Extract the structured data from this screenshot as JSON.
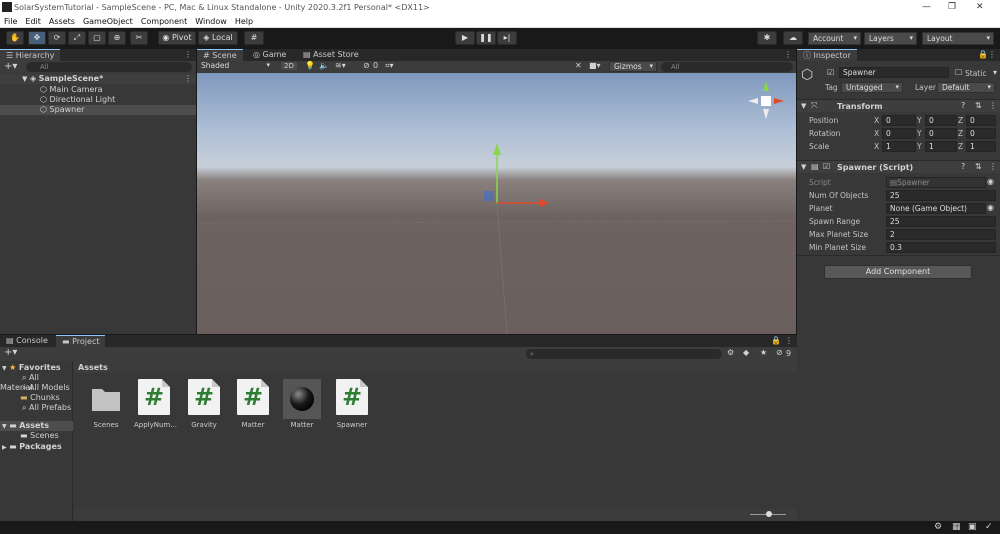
{
  "window": {
    "title": "SolarSystemTutorial - SampleScene - PC, Mac & Linux Standalone - Unity 2020.3.2f1 Personal* <DX11>",
    "minimize": "—",
    "maximize": "❐",
    "close": "✕"
  },
  "menu": [
    "File",
    "Edit",
    "Assets",
    "GameObject",
    "Component",
    "Window",
    "Help"
  ],
  "toolbar": {
    "pivot": "Pivot",
    "local": "Local",
    "account": "Account",
    "layers": "Layers",
    "layout": "Layout"
  },
  "hierarchy": {
    "tab": "Hierarchy",
    "search_placeholder": "All",
    "scene": "SampleScene*",
    "items": [
      "Main Camera",
      "Directional Light",
      "Spawner"
    ]
  },
  "scene_view": {
    "tabs": [
      "Scene",
      "Game",
      "Asset Store"
    ],
    "shading": "Shaded",
    "mode": "2D",
    "hidden_count": "0",
    "gizmos": "Gizmos",
    "search_placeholder": "All"
  },
  "inspector": {
    "tab": "Inspector",
    "object_name": "Spawner",
    "static_label": "Static",
    "tag_label": "Tag",
    "tag_value": "Untagged",
    "layer_label": "Layer",
    "layer_value": "Default",
    "transform": {
      "title": "Transform",
      "rows": [
        {
          "label": "Position",
          "x": "0",
          "y": "0",
          "z": "0"
        },
        {
          "label": "Rotation",
          "x": "0",
          "y": "0",
          "z": "0"
        },
        {
          "label": "Scale",
          "x": "1",
          "y": "1",
          "z": "1"
        }
      ],
      "x_label": "X",
      "y_label": "Y",
      "z_label": "Z"
    },
    "spawner": {
      "title": "Spawner (Script)",
      "fields": [
        {
          "label": "Script",
          "value": "Spawner"
        },
        {
          "label": "Num Of Objects",
          "value": "25"
        },
        {
          "label": "Planet",
          "value": "None (Game Object)"
        },
        {
          "label": "Spawn Range",
          "value": "25"
        },
        {
          "label": "Max Planet Size",
          "value": "2"
        },
        {
          "label": "Min Planet Size",
          "value": "0.3"
        }
      ]
    },
    "add_component": "Add Component"
  },
  "project": {
    "tabs": [
      "Console",
      "Project"
    ],
    "hidden_count": "9",
    "favorites": {
      "label": "Favorites",
      "items": [
        "All Material",
        "All Models",
        "Chunks",
        "All Prefabs"
      ]
    },
    "assets_tree": {
      "label": "Assets",
      "children": [
        "Scenes"
      ]
    },
    "packages": "Packages",
    "breadcrumb": "Assets",
    "assets": [
      {
        "name": "Scenes",
        "kind": "folder"
      },
      {
        "name": "ApplyNum...",
        "kind": "script"
      },
      {
        "name": "Gravity",
        "kind": "script"
      },
      {
        "name": "Matter",
        "kind": "script"
      },
      {
        "name": "Matter",
        "kind": "material"
      },
      {
        "name": "Spawner",
        "kind": "script"
      }
    ]
  },
  "colors": {
    "accent": "#46607c",
    "selected_row": "#4d4d4d",
    "script_hash": "#2e7d32"
  }
}
